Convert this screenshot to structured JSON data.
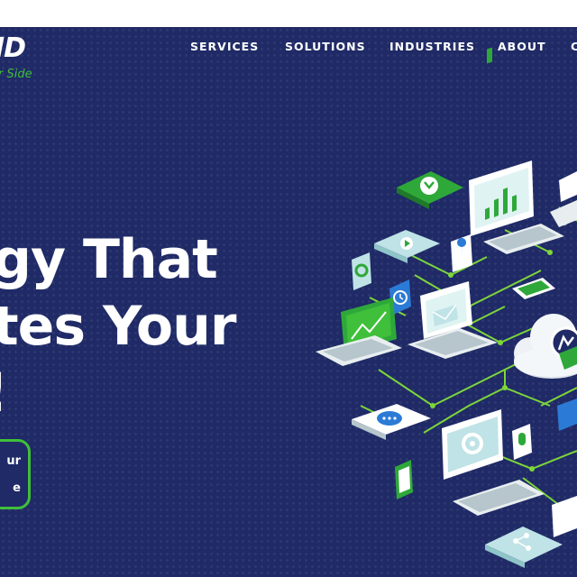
{
  "header": {
    "logo_text": "ID",
    "logo_tagline": "r Side"
  },
  "nav": {
    "items": [
      "SERVICES",
      "SOLUTIONS",
      "INDUSTRIES",
      "ABOUT",
      "C"
    ]
  },
  "hero": {
    "headline_lines": [
      "gy That",
      "tes Your",
      "!"
    ],
    "cta_lines": [
      "ur",
      "e"
    ]
  },
  "colors": {
    "background": "#1f2a66",
    "accent_green": "#3fbf3a",
    "connector": "#7dd63a",
    "teal": "#bfe3e6",
    "white": "#ffffff"
  }
}
